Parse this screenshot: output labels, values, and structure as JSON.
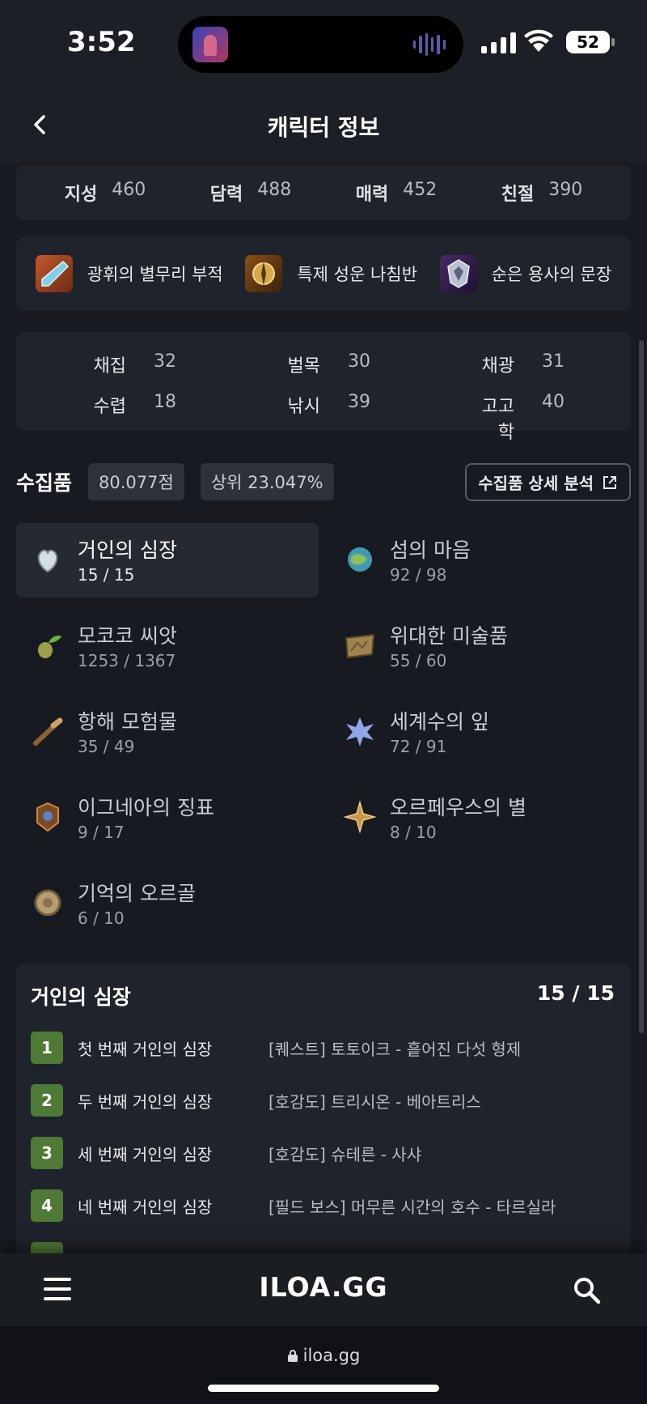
{
  "status": {
    "time": "3:52",
    "battery": "52"
  },
  "header": {
    "title": "캐릭터 정보"
  },
  "stats": [
    {
      "label": "지성",
      "value": "460"
    },
    {
      "label": "담력",
      "value": "488"
    },
    {
      "label": "매력",
      "value": "452"
    },
    {
      "label": "친절",
      "value": "390"
    }
  ],
  "relics": [
    {
      "name": "광휘의 별무리 부적",
      "icon": "charm-icon"
    },
    {
      "name": "특제 성운 나침반",
      "icon": "compass-icon"
    },
    {
      "name": "순은 용사의 문장",
      "icon": "crest-icon"
    }
  ],
  "life": [
    {
      "label": "채집",
      "value": "32"
    },
    {
      "label": "벌목",
      "value": "30"
    },
    {
      "label": "채광",
      "value": "31"
    },
    {
      "label": "수렵",
      "value": "18"
    },
    {
      "label": "낚시",
      "value": "39"
    },
    {
      "label": "고고학",
      "value": "40"
    }
  ],
  "collection": {
    "title": "수집품",
    "score": "80.077점",
    "rank": "상위 23.047%",
    "detail_button": "수집품 상세 분석",
    "items": [
      {
        "name": "거인의 심장",
        "count": "15 / 15",
        "icon": "giant-heart-icon"
      },
      {
        "name": "섬의 마음",
        "count": "92 / 98",
        "icon": "island-heart-icon"
      },
      {
        "name": "모코코 씨앗",
        "count": "1253 / 1367",
        "icon": "mokoko-seed-icon"
      },
      {
        "name": "위대한 미술품",
        "count": "55 / 60",
        "icon": "artwork-icon"
      },
      {
        "name": "항해 모험물",
        "count": "35 / 49",
        "icon": "spyglass-icon"
      },
      {
        "name": "세계수의 잎",
        "count": "72 / 91",
        "icon": "leaf-icon"
      },
      {
        "name": "이그네아의 징표",
        "count": "9 / 17",
        "icon": "ignea-token-icon"
      },
      {
        "name": "오르페우스의 별",
        "count": "8 / 10",
        "icon": "star-icon"
      },
      {
        "name": "기억의 오르골",
        "count": "6 / 10",
        "icon": "music-box-icon"
      }
    ]
  },
  "detail": {
    "title": "거인의 심장",
    "count": "15 / 15",
    "rows": [
      {
        "num": "1",
        "name": "첫 번째 거인의 심장",
        "source": "[퀘스트] 토토이크 - 흩어진 다섯 형제"
      },
      {
        "num": "2",
        "name": "두 번째 거인의 심장",
        "source": "[호감도] 트리시온 - 베아트리스"
      },
      {
        "num": "3",
        "name": "세 번째 거인의 심장",
        "source": "[호감도] 슈테른 - 사샤"
      },
      {
        "num": "4",
        "name": "네 번째 거인의 심장",
        "source": "[필드 보스] 머무른 시간의 호수 - 타르실라"
      }
    ]
  },
  "nav": {
    "logo": "ILOA.GG"
  },
  "browser": {
    "url": "iloa.gg"
  }
}
